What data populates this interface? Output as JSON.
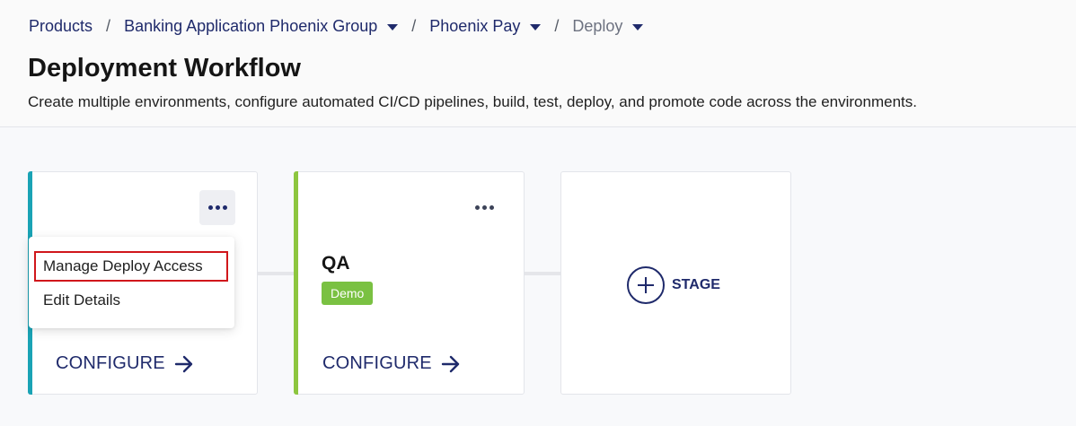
{
  "breadcrumb": {
    "items": [
      {
        "label": "Products",
        "has_caret": false
      },
      {
        "label": "Banking Application Phoenix Group",
        "has_caret": true
      },
      {
        "label": "Phoenix Pay",
        "has_caret": true
      },
      {
        "label": "Deploy",
        "has_caret": true
      }
    ],
    "separator": "/"
  },
  "header": {
    "title": "Deployment Workflow",
    "subtitle": "Create multiple environments, configure automated CI/CD pipelines, build, test, deploy, and promote code across the environments."
  },
  "stages": [
    {
      "name": "",
      "badge": "",
      "accent_color": "#1aa3b5",
      "configure_label": "CONFIGURE"
    },
    {
      "name": "QA",
      "badge": "Demo",
      "accent_color": "#8dc63f",
      "configure_label": "CONFIGURE"
    }
  ],
  "add_stage": {
    "label": "STAGE"
  },
  "context_menu": {
    "items": [
      "Manage Deploy Access",
      "Edit Details"
    ]
  },
  "icons": {
    "more": "more-horizontal-icon",
    "arrow": "arrow-right-icon",
    "plus": "plus-circle-icon",
    "caret": "caret-down-icon"
  },
  "colors": {
    "primary": "#1f2a6b",
    "badge": "#7ac142",
    "highlight": "#d0171b"
  }
}
